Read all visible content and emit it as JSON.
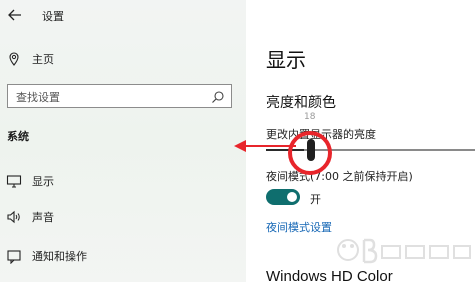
{
  "window": {
    "title": "设置"
  },
  "sidebar": {
    "home_label": "主页",
    "search_placeholder": "查找设置",
    "section_heading": "系统",
    "items": [
      {
        "label": "显示",
        "icon": "monitor-icon"
      },
      {
        "label": "声音",
        "icon": "speaker-icon"
      },
      {
        "label": "通知和操作",
        "icon": "notification-icon"
      }
    ]
  },
  "main": {
    "page_title": "显示",
    "section_title": "亮度和颜色",
    "brightness_label": "更改内置显示器的亮度",
    "brightness_value": "18",
    "brightness_level": 18,
    "night_light_label": "夜间模式(7:00 之前保持开启)",
    "toggle_state": "开",
    "toggle_on": true,
    "night_light_link": "夜间模式设置",
    "hd_color_title": "Windows HD Color"
  },
  "colors": {
    "accent": "#0f6e6e",
    "link": "#1667b5",
    "annotation": "#e8252b"
  }
}
